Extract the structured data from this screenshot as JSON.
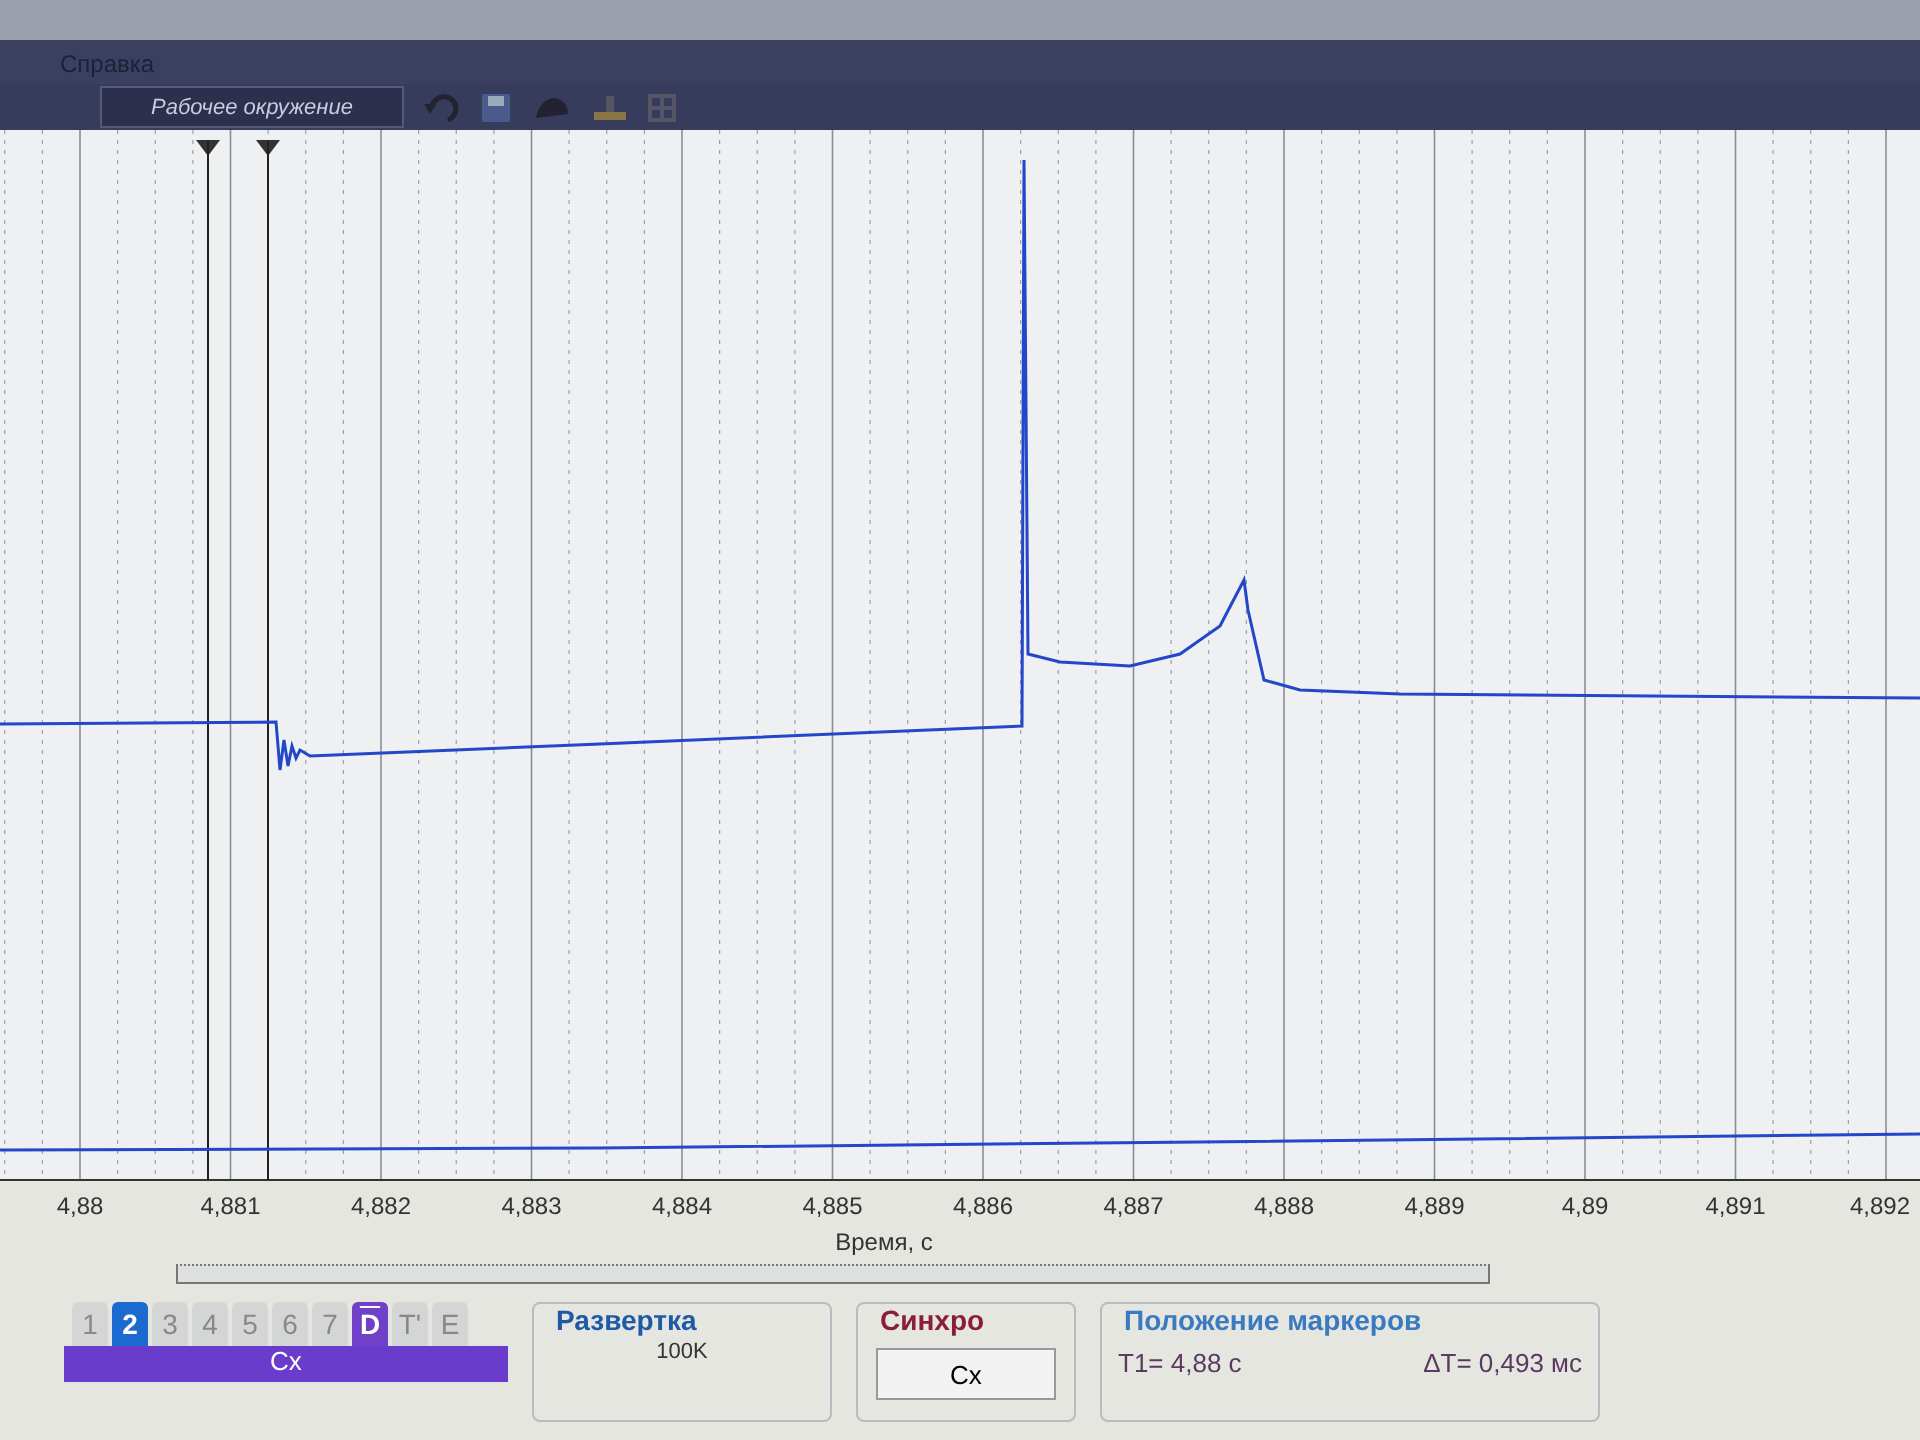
{
  "menu": {
    "items": [
      "Справка"
    ]
  },
  "toolbar": {
    "environment": "Рабочее окружение"
  },
  "plot": {
    "xticks": [
      "4,88",
      "4,881",
      "4,882",
      "4,883",
      "4,884",
      "4,885",
      "4,886",
      "4,887",
      "4,888",
      "4,889",
      "4,89",
      "4,891",
      "4,892"
    ],
    "xlabel": "Время, с"
  },
  "tabs": [
    {
      "label": "1",
      "kind": "channel",
      "selected": false
    },
    {
      "label": "2",
      "kind": "channel",
      "selected": true
    },
    {
      "label": "3",
      "kind": "channel",
      "selected": false
    },
    {
      "label": "4",
      "kind": "channel",
      "selected": false
    },
    {
      "label": "5",
      "kind": "channel",
      "selected": false
    },
    {
      "label": "6",
      "kind": "channel",
      "selected": false
    },
    {
      "label": "7",
      "kind": "channel",
      "selected": false
    },
    {
      "label": "D",
      "kind": "digital",
      "selected": true
    },
    {
      "label": "T'",
      "kind": "other",
      "selected": false
    },
    {
      "label": "E",
      "kind": "other",
      "selected": false
    }
  ],
  "channel_panel": {
    "label": "Cx"
  },
  "sweep": {
    "title": "Развертка",
    "value": "100K"
  },
  "sync": {
    "title": "Синхро",
    "button": "Cx"
  },
  "marker_positions": {
    "title": "Положение маркеров",
    "t1": "T1= 4,88 с",
    "delta_t": "ΔT= 0,493 мс"
  }
}
